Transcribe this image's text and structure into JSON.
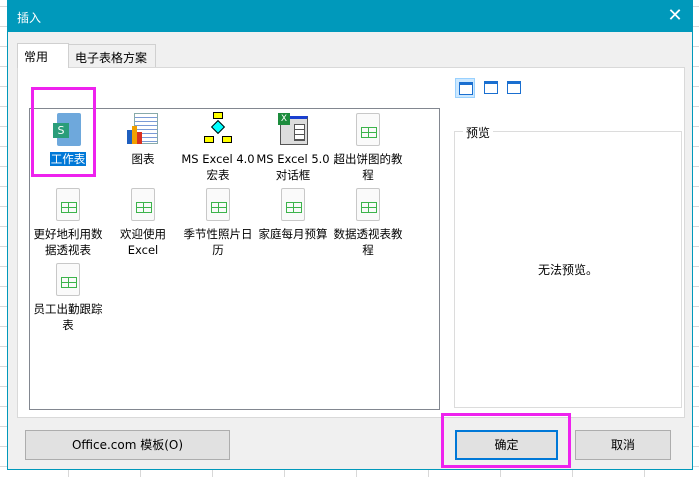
{
  "dialog": {
    "title": "插入",
    "close_icon": "close-icon"
  },
  "tabs": [
    {
      "label": "常用",
      "active": true
    },
    {
      "label": "电子表格方案",
      "active": false
    }
  ],
  "items": [
    {
      "label": "工作表",
      "icon": "worksheet-icon",
      "selected": true
    },
    {
      "label": "图表",
      "icon": "chart-icon"
    },
    {
      "label": "MS Excel 4.0 宏表",
      "icon": "macro-sheet-icon"
    },
    {
      "label": "MS Excel 5.0 对话框",
      "icon": "dialog-sheet-icon"
    },
    {
      "label": "超出饼图的教程",
      "icon": "template-icon"
    },
    {
      "label": "更好地利用数据透视表",
      "icon": "template-icon"
    },
    {
      "label": "欢迎使用 Excel",
      "icon": "template-icon"
    },
    {
      "label": "季节性照片日历",
      "icon": "template-icon"
    },
    {
      "label": "家庭每月预算",
      "icon": "template-icon"
    },
    {
      "label": "数据透视表教程",
      "icon": "template-icon"
    },
    {
      "label": "员工出勤跟踪表",
      "icon": "template-icon"
    }
  ],
  "view_buttons": [
    "large-icons-view",
    "list-view",
    "details-view"
  ],
  "preview": {
    "label": "预览",
    "message": "无法预览。"
  },
  "buttons": {
    "office_templates": "Office.com 模板(O)",
    "ok": "确定",
    "cancel": "取消"
  },
  "colors": {
    "titlebar": "#0099bb",
    "highlight": "#ee22ee",
    "selection": "#0078d7"
  }
}
